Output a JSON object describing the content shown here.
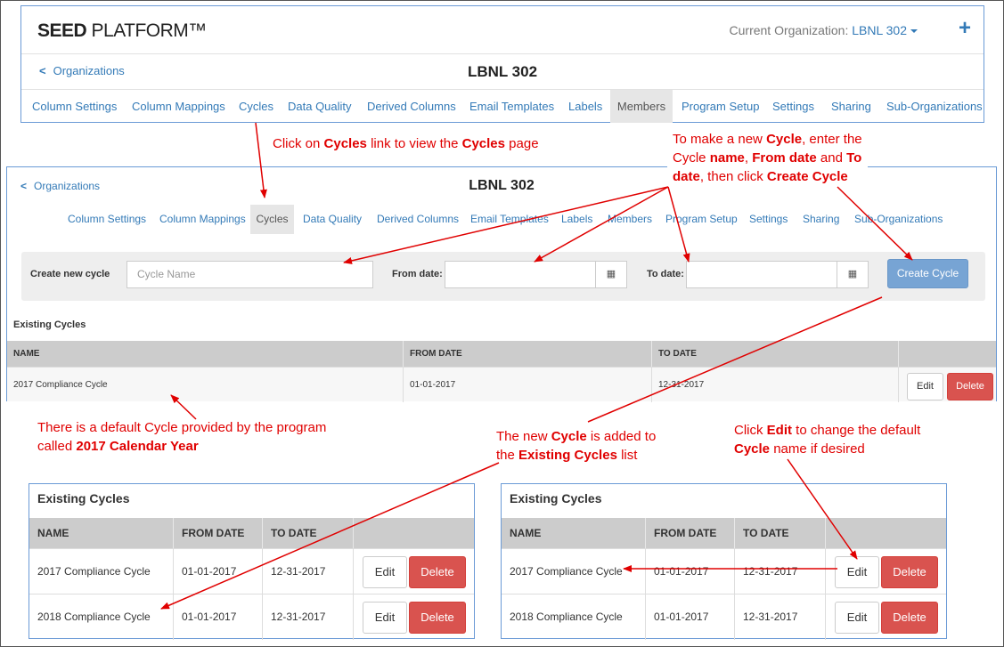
{
  "app": {
    "brand_bold": "SEED",
    "brand_rest": " PLATFORM™"
  },
  "header": {
    "org_label": "Current Organization:",
    "org_value": "LBNL 302"
  },
  "nav": {
    "back_label": "Organizations",
    "page_title": "LBNL 302"
  },
  "tabs": [
    "Column Settings",
    "Column Mappings",
    "Cycles",
    "Data Quality",
    "Derived Columns",
    "Email Templates",
    "Labels",
    "Members",
    "Program Setup",
    "Settings",
    "Sharing",
    "Sub-Organizations"
  ],
  "form": {
    "create_label": "Create new cycle",
    "name_placeholder": "Cycle Name",
    "from_label": "From date:",
    "to_label": "To date:",
    "create_button": "Create Cycle"
  },
  "table": {
    "heading": "Existing Cycles",
    "columns": [
      "NAME",
      "FROM DATE",
      "TO DATE"
    ],
    "edit_label": "Edit",
    "delete_label": "Delete",
    "rows": [
      {
        "name": "2017 Compliance Cycle",
        "from": "01-01-2017",
        "to": "12-31-2017"
      },
      {
        "name": "2018 Compliance Cycle",
        "from": "01-01-2017",
        "to": "12-31-2017"
      }
    ]
  },
  "annotations": {
    "cycles_link": {
      "p1": "Click on ",
      "b1": "Cycles",
      "p2": " link to view the ",
      "b2": "Cycles",
      "p3": " page"
    },
    "make_new": {
      "p1": "To make a new ",
      "b1": "Cycle",
      "p2": ", enter the",
      "p3": "Cycle ",
      "b2": "name",
      "p4": ", ",
      "b3": "From date",
      "p5": " and ",
      "b4": "To",
      "b5": "date",
      "p6": ", then click ",
      "b6": "Create Cycle"
    },
    "default_cycle": {
      "p1": "There is a default Cycle provided by the program",
      "p2": "called ",
      "b1": "2017 Calendar Year"
    },
    "added": {
      "p1": "The new ",
      "b1": "Cycle",
      "p2": " is added to",
      "p3": "the ",
      "b2": "Existing Cycles",
      "p4": " list"
    },
    "edit_tip": {
      "p1": "Click ",
      "b1": "Edit",
      "p2": " to change the default",
      "b2": "Cycle",
      "p3": " name if desired"
    }
  },
  "colors": {
    "link": "#337ab7",
    "annotation": "#e00000",
    "delete": "#d9534f",
    "create": "#77a4d4",
    "table_header": "#cccccc"
  },
  "icons": {
    "calendar": "calendar-icon",
    "back": "chevron-left-icon",
    "plus": "plus-icon",
    "dropdown": "caret-down-icon"
  }
}
